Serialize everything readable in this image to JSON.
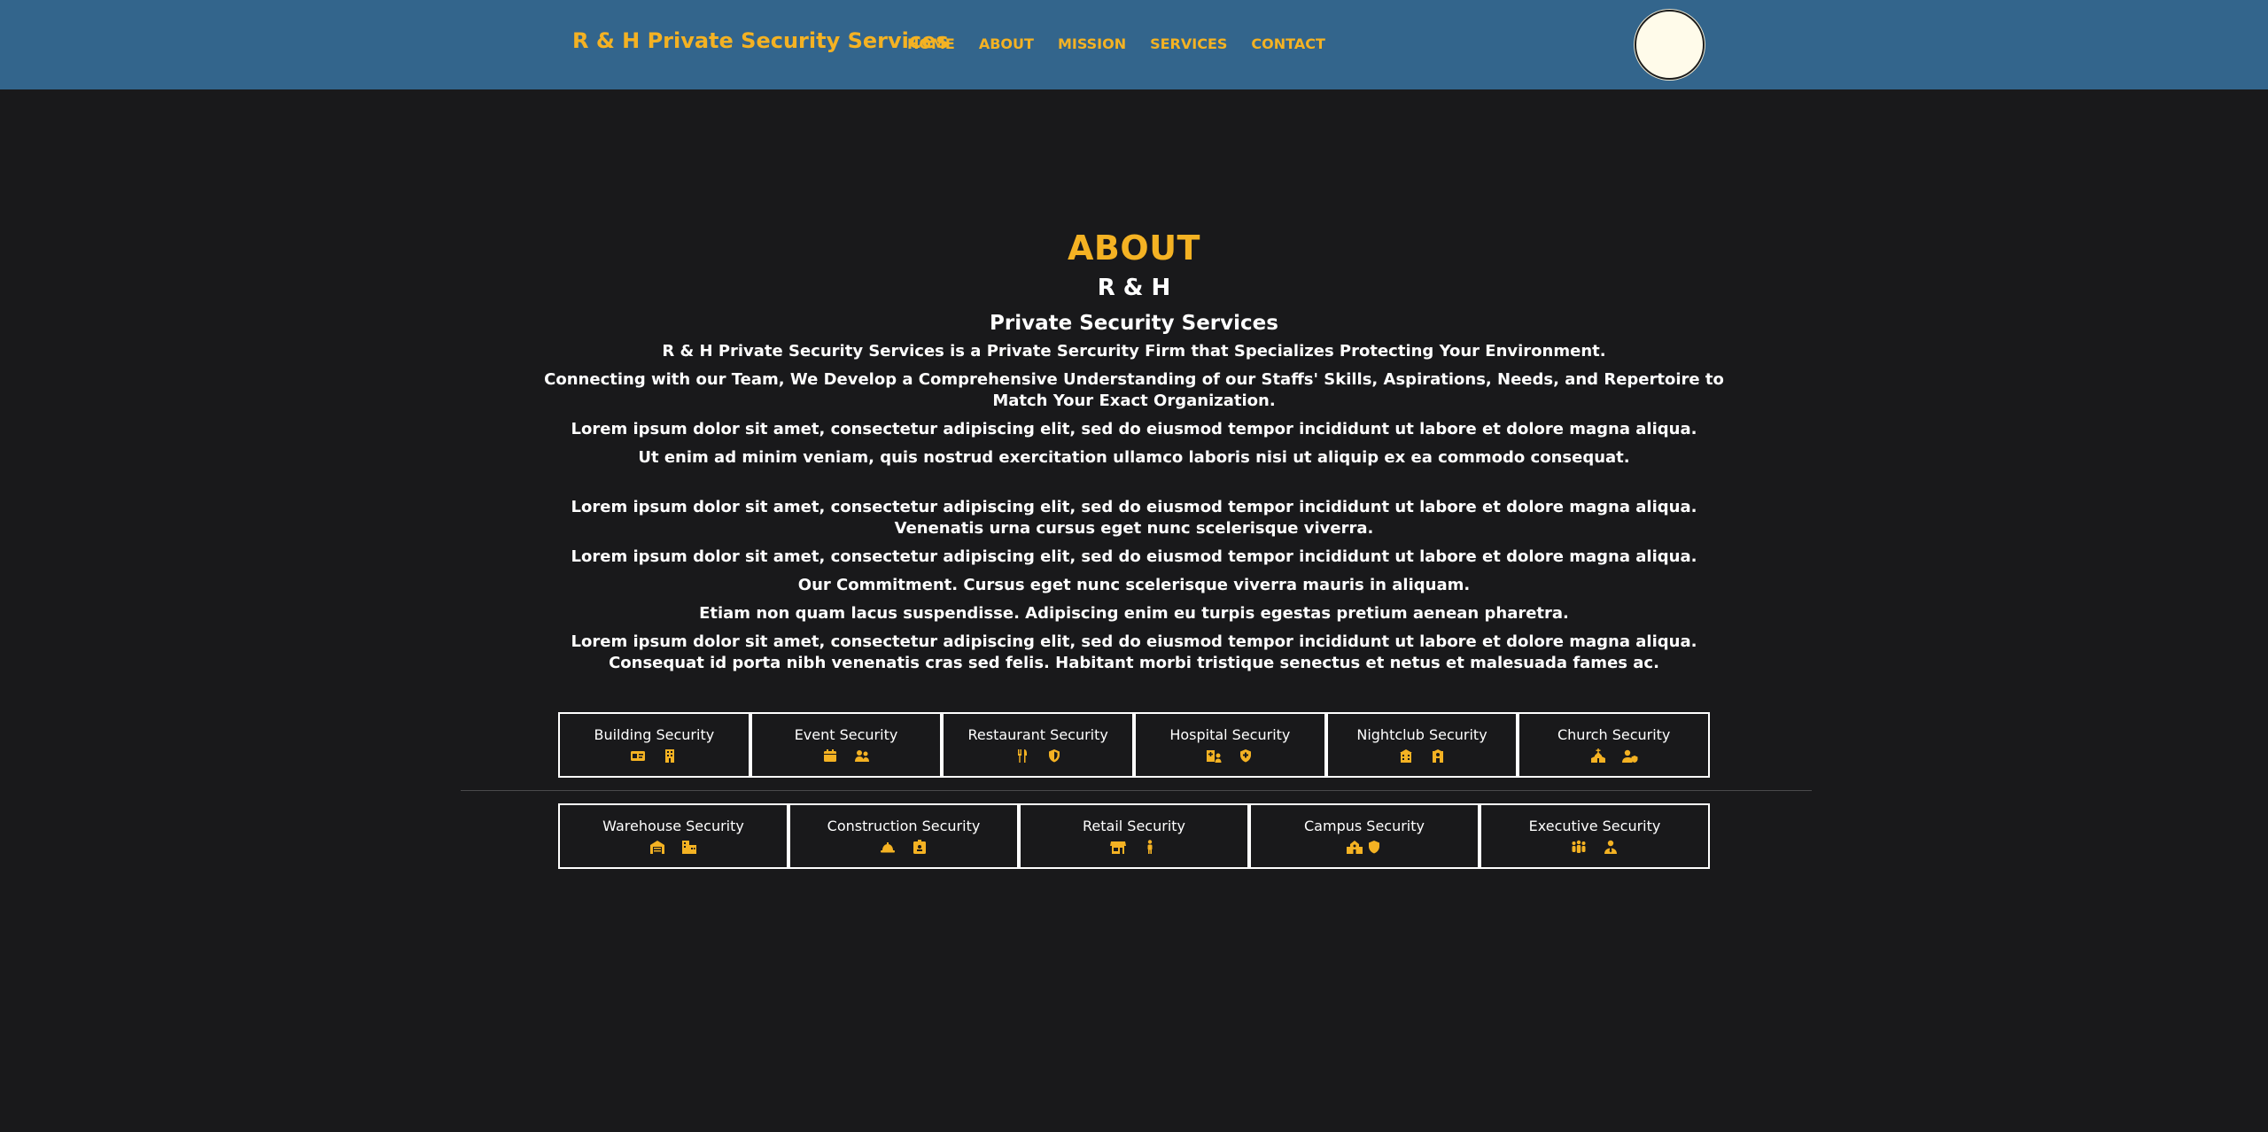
{
  "header": {
    "brand": "R & H Private Security Services",
    "nav": [
      "HOME",
      "ABOUT",
      "MISSION",
      "SERVICES",
      "CONTACT"
    ]
  },
  "about": {
    "heading": "ABOUT",
    "subtitle": "R & H",
    "subtitle2": "Private Security Services",
    "paragraphs": [
      "R & H Private Security Services is a Private Sercurity Firm that Specializes Protecting Your Environment.",
      "Connecting with our Team, We Develop a Comprehensive Understanding of our Staffs' Skills, Aspirations, Needs, and Repertoire to Match Your Exact Organization.",
      "Lorem ipsum dolor sit amet, consectetur adipiscing elit, sed do eiusmod tempor incididunt ut labore et dolore magna aliqua.",
      "Ut enim ad minim veniam, quis nostrud exercitation ullamco laboris nisi ut aliquip ex ea commodo consequat.",
      "Lorem ipsum dolor sit amet, consectetur adipiscing elit, sed do eiusmod tempor incididunt ut labore et dolore magna aliqua. Venenatis urna cursus eget nunc scelerisque viverra.",
      "Lorem ipsum dolor sit amet, consectetur adipiscing elit, sed do eiusmod tempor incididunt ut labore et dolore magna aliqua.",
      "Our Commitment. Cursus eget nunc scelerisque viverra mauris in aliquam.",
      "Etiam non quam lacus suspendisse. Adipiscing enim eu turpis egestas pretium aenean pharetra.",
      "Lorem ipsum dolor sit amet, consectetur adipiscing elit, sed do eiusmod tempor incididunt ut labore et dolore magna aliqua. Consequat id porta nibh venenatis cras sed felis. Habitant morbi tristique senectus et netus et malesuada fames ac."
    ]
  },
  "services_row1": [
    {
      "label": "Building Security",
      "icons": [
        "id-card-icon",
        "building-icon"
      ]
    },
    {
      "label": "Event Security",
      "icons": [
        "calendar-icon",
        "users-icon"
      ]
    },
    {
      "label": "Restaurant Security",
      "icons": [
        "utensils-icon",
        "shield-icon"
      ]
    },
    {
      "label": "Hospital Security",
      "icons": [
        "hospital-user-icon",
        "shield-cross-icon"
      ]
    },
    {
      "label": "Nightclub Security",
      "icons": [
        "dance-icon",
        "bouncer-icon"
      ]
    },
    {
      "label": "Church Security",
      "icons": [
        "church-icon",
        "user-shield-icon"
      ]
    }
  ],
  "services_row2": [
    {
      "label": "Warehouse Security",
      "icons": [
        "warehouse-icon",
        "industry-icon"
      ]
    },
    {
      "label": "Construction Security",
      "icons": [
        "hard-hat-icon",
        "badge-icon"
      ]
    },
    {
      "label": "Retail Security",
      "icons": [
        "store-icon",
        "person-icon"
      ]
    },
    {
      "label": "Campus Security",
      "icons": [
        "school-icon",
        "shield-icon"
      ]
    },
    {
      "label": "Executive Security",
      "icons": [
        "people-group-icon",
        "user-tie-icon"
      ]
    }
  ],
  "colors": {
    "accent": "#f4b223",
    "header_bg": "#33658c",
    "page_bg": "#19191b"
  }
}
